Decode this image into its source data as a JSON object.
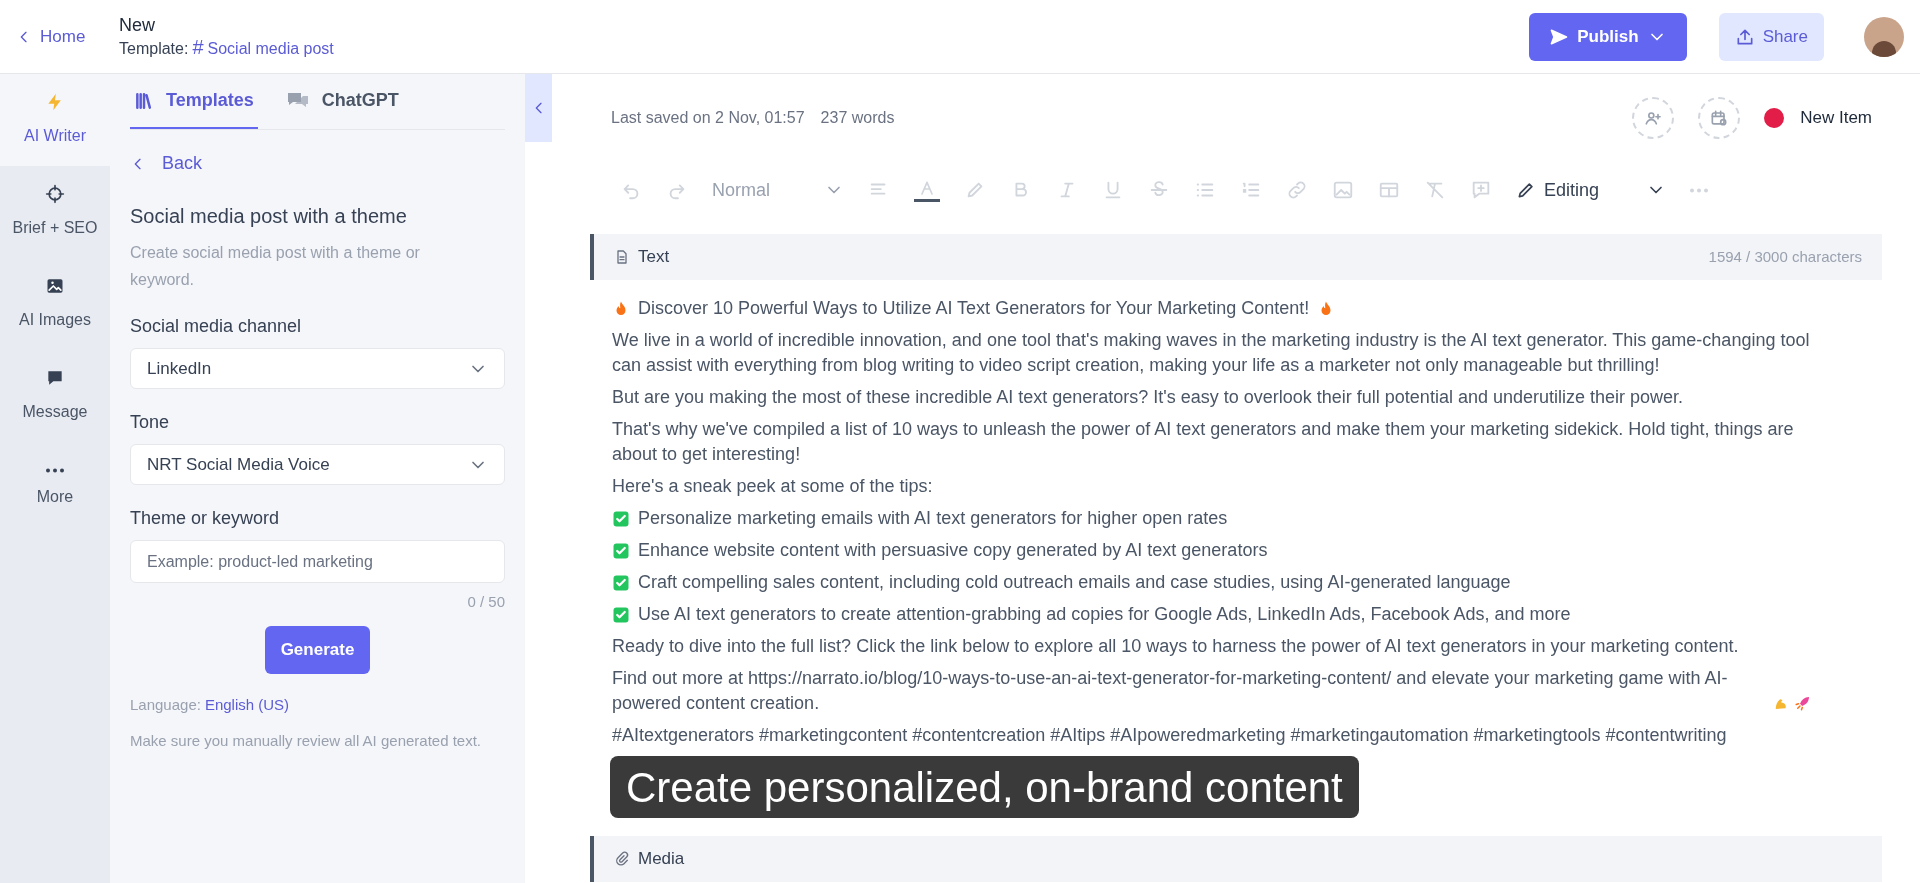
{
  "header": {
    "back": "Home",
    "title": "New",
    "template_label": "Template:",
    "template_icon": "#",
    "template_name": "Social media post",
    "publish": "Publish",
    "share": "Share"
  },
  "rail": [
    {
      "kind": "bolt",
      "label": "AI Writer",
      "selected": true
    },
    {
      "kind": "target",
      "label": "Brief + SEO",
      "selected": false
    },
    {
      "kind": "image",
      "label": "AI Images",
      "selected": false
    },
    {
      "kind": "chat",
      "label": "Message",
      "selected": false
    },
    {
      "kind": "dots",
      "label": "More",
      "selected": false
    }
  ],
  "panel": {
    "tabs": [
      {
        "kind": "books",
        "label": "Templates",
        "selected": true
      },
      {
        "kind": "chat",
        "label": "ChatGPT",
        "selected": false
      }
    ],
    "back": "Back",
    "title": "Social media post with a theme",
    "description": "Create social media post with a theme or keyword.",
    "fields": [
      {
        "kind": "select",
        "label": "Social media channel",
        "value": "LinkedIn"
      },
      {
        "kind": "select",
        "label": "Tone",
        "value": "NRT Social Media Voice"
      },
      {
        "kind": "text",
        "label": "Theme or keyword",
        "placeholder": "Example: product-led marketing",
        "counter": "0 / 50"
      }
    ],
    "generate": "Generate",
    "language_label": "Language:",
    "language": "English (US)",
    "note": "Make sure you manually review all AI generated text."
  },
  "status": {
    "saved": "Last saved on 2 Nov, 01:57",
    "words": "237 words",
    "item": {
      "label": "New Item",
      "color": "#e11d48"
    }
  },
  "toolbar": {
    "style": "Normal",
    "mode": "Editing"
  },
  "text_section": {
    "title": "Text",
    "count": "1594 / 3000 characters",
    "paragraphs": [
      {
        "kind": "fire",
        "text": "Discover 10 Powerful Ways to Utilize AI Text Generators for Your Marketing Content!"
      },
      {
        "kind": "plain",
        "text": "We live in a world of incredible innovation, and one tool that's making waves in the marketing industry is the AI text generator. This game-changing tool can assist with everything from blog writing to video script creation, making your life as a marketer not only manageable but thrilling!"
      },
      {
        "kind": "plain",
        "text": "But are you making the most of these incredible AI text generators? It's easy to overlook their full potential and underutilize their power."
      },
      {
        "kind": "plain",
        "text": "That's why we've compiled a list of 10 ways to unleash the power of AI text generators and make them your marketing sidekick. Hold tight, things are about to get interesting!"
      },
      {
        "kind": "plain",
        "text": "Here's a sneak peek at some of the tips:"
      },
      {
        "kind": "check",
        "text": "Personalize marketing emails with AI text generators for higher open rates"
      },
      {
        "kind": "check",
        "text": "Enhance website content with persuasive copy generated by AI text generators"
      },
      {
        "kind": "check",
        "text": "Craft compelling sales content, including cold outreach emails and case studies, using AI-generated language"
      },
      {
        "kind": "check",
        "text": "Use AI text generators to create attention-grabbing ad copies for Google Ads, LinkedIn Ads, Facebook Ads, and more"
      },
      {
        "kind": "plain",
        "text": "Ready to dive into the full list? Click the link below to explore all 10 ways to harness the power of AI text generators in your marketing content."
      },
      {
        "kind": "rocket",
        "text": "Find out more at https://narrato.io/blog/10-ways-to-use-an-ai-text-generator-for-marketing-content/ and elevate your marketing game with AI-powered content creation."
      },
      {
        "kind": "plain",
        "text": "#AItextgenerators #marketingcontent #contentcreation #AItips #AIpoweredmarketing #marketingautomation #marketingtools #contentwriting"
      }
    ]
  },
  "media_section": {
    "title": "Media"
  },
  "caption": "Create personalized, on-brand content"
}
